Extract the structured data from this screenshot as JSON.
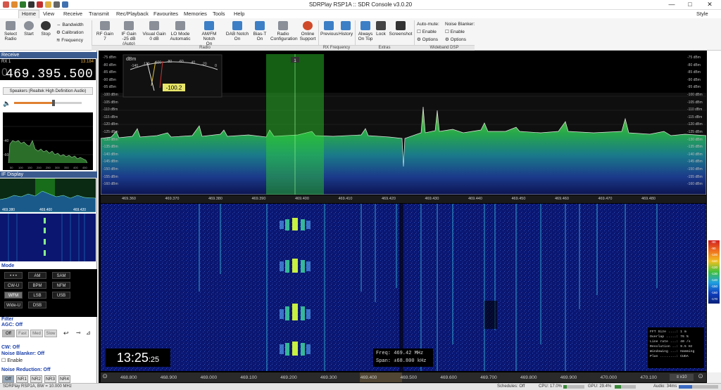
{
  "window": {
    "title": "SDRPlay RSP1A :: SDR Console v3.0.20",
    "minimize": "—",
    "maximize": "□",
    "close": "✕",
    "style": "Style"
  },
  "menu": [
    "Home",
    "View",
    "Receive",
    "Transmit",
    "Rec/Playback",
    "Favourites",
    "Memories",
    "Tools",
    "Help"
  ],
  "ribbon": {
    "select_radio": "Select\nRadio",
    "start": "Start",
    "stop": "Stop",
    "bandwidth": "Bandwidth",
    "calibration": "Calibration",
    "frequency": "Frequency",
    "rf_gain": "RF Gain",
    "rf_gain_val": "7",
    "if_gain": "IF Gain",
    "if_gain_val": "-25 dB (Auto)",
    "visual_gain": "Visual Gain",
    "visual_gain_val": "0 dB",
    "lo_mode": "LO Mode",
    "lo_mode_val": "Automatic",
    "am_fm_notch": "AM/FM Notch",
    "am_fm_notch_val": "On",
    "dab_notch": "DAB Notch",
    "dab_notch_val": "On",
    "bias_t": "Bias-T",
    "bias_t_val": "On",
    "radio_config": "Radio\nConfiguration",
    "online_support": "Online\nSupport",
    "previous": "Previous",
    "history": "History",
    "always_on_top": "Always\nOn Top",
    "lock": "Lock",
    "screenshot": "Screenshot",
    "auto_mute": "Auto-mute:",
    "enable1": "Enable",
    "options1": "Options",
    "noise_blanker": "Noise Blanker:",
    "enable2": "Enable",
    "options2": "Options",
    "groups": {
      "radio": "Radio",
      "rx_freq": "RX Frequency",
      "extras": "Extras",
      "wideband": "Wideband DSP"
    }
  },
  "left": {
    "receive": "Receive",
    "rx": "RX 1",
    "rx_right": "13.184",
    "frequency": "469.395.500",
    "speaker": "Speakers (Realtek High Definition Audio)",
    "if_display": "IF Display",
    "if_labels": [
      "469.380",
      "469.400",
      "469.420"
    ],
    "mode": "Mode",
    "modes": [
      "• • •",
      "AM",
      "SAM",
      "CW-U",
      "BPM",
      "NFM",
      "WFM",
      "LSB",
      "USB",
      "Wide-U",
      "DSB"
    ],
    "selected_mode": "WFM",
    "filter": "Filter",
    "agc": "AGC: Off",
    "agc_btns": [
      "Off",
      "Fast",
      "Med",
      "Slow"
    ],
    "cw": "CW: Off",
    "nb": "Noise Blanker: Off",
    "enable": "Enable",
    "nr": "Noise Reduction: Off",
    "nr_btns": [
      "Off",
      "NR1",
      "NR2",
      "NR3",
      "NR4"
    ],
    "mini_labels": [
      "50",
      "100",
      "150",
      "200",
      "250",
      "300",
      "350",
      "400",
      "450"
    ],
    "mini_dbm": [
      "-40",
      "-60"
    ]
  },
  "spectrum": {
    "db_labels_left": [
      "-75 dBm",
      "-80 dBm",
      "-85 dBm",
      "-90 dBm",
      "-95 dBm",
      "-100 dBm",
      "-105 dBm",
      "-110 dBm",
      "-115 dBm",
      "-120 dBm",
      "-125 dBm",
      "-130 dBm",
      "-135 dBm",
      "-140 dBm",
      "-145 dBm",
      "-150 dBm",
      "-155 dBm",
      "-160 dBm"
    ],
    "db_labels_right": [
      "-75 dBm",
      "-80 dBm",
      "-85 dBm",
      "-90 dBm",
      "-95 dBm",
      "-100 dBm",
      "-105 dBm",
      "-110 dBm",
      "-115 dBm",
      "-120 dBm",
      "-125 dBm",
      "-130 dBm",
      "-135 dBm",
      "-140 dBm",
      "-145 dBm",
      "-150 dBm",
      "-155 dBm",
      "-160 dBm"
    ],
    "freq_labels": [
      "469.360",
      "469.370",
      "469.380",
      "469.390",
      "469.400",
      "469.410",
      "469.420",
      "469.430",
      "469.440",
      "469.450",
      "469.460",
      "469.470",
      "469.480"
    ],
    "meter_title": "dBm",
    "meter_scale": [
      "-140",
      "-120",
      "-100",
      "-80",
      "-60",
      "-40",
      "-20",
      "0"
    ],
    "meter_value": "-100.2",
    "channel_marker": "1"
  },
  "waterfall": {
    "clock_main": "13:25",
    "clock_sec": ":25",
    "freq_line": "Freq:  469.42 MHz",
    "span_line": "Span: ±68.800 kHz",
    "fft": [
      "FFT Size ....: 1 m",
      "Overlap .....: 76 %",
      "Line rate ...: 40 /s",
      "Resolution ..: 9.5 Hz",
      "Windowing ...: Hamming",
      "Plan ........: CUDA"
    ],
    "bottom_freqs": [
      "468.800",
      "468.900",
      "469.000",
      "469.100",
      "469.200",
      "469.300",
      "469.400",
      "469.500",
      "469.600",
      "469.700",
      "469.800",
      "469.900",
      "470.000",
      "470.100"
    ],
    "zoom": "x10",
    "scale": [
      "-80",
      "-90",
      "-100",
      "-110",
      "-120",
      "-130",
      "-140",
      "-150",
      "-160",
      "-170"
    ]
  },
  "status": {
    "left": "SDRPlay RSP1A, BW = 10.000 MHz",
    "schedules": "Schedules: Off",
    "cpu": "CPU: 17.0%",
    "gpu": "GPU: 29.4%",
    "audio": "Audio: 34ms"
  },
  "colors": {
    "accent": "#3d7fc6",
    "spectrum_fill": "#22a822",
    "waterfall_bg": "#0a1670",
    "header": "#3b5b8e"
  }
}
